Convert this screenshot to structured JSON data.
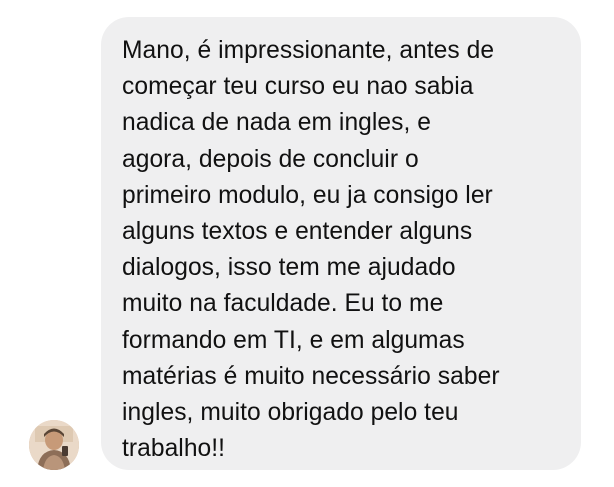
{
  "message": {
    "text": "Mano, é impressionante, antes de\ncomeçar teu curso eu nao sabia\nnadica de nada em ingles, e\nagora, depois de concluir o\nprimeiro modulo, eu ja consigo ler\nalguns textos e entender alguns\ndialogos, isso tem me ajudado\nmuito na faculdade. Eu to me\nformando em TI, e em algumas\nmatérias é muito necessário saber\ningles, muito obrigado pelo teu\ntrabalho!!"
  },
  "colors": {
    "bubble_background": "#efeff0",
    "text": "#111111",
    "page_background": "#ffffff"
  },
  "icons": {
    "avatar": "user-avatar-photo"
  }
}
